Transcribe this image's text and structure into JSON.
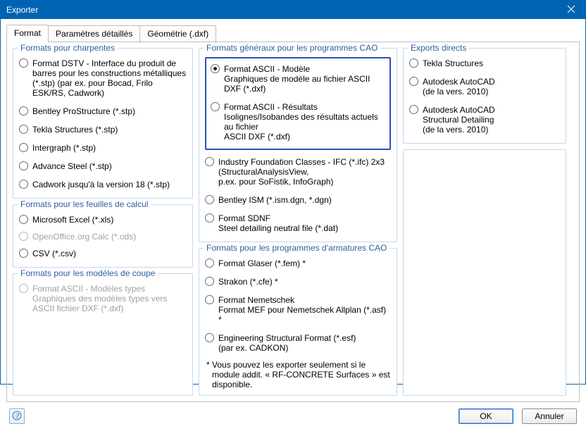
{
  "window": {
    "title": "Exporter"
  },
  "tabs": {
    "format": "Format",
    "detailed": "Paramètres détaillés",
    "geometry": "Géométrie (.dxf)"
  },
  "left": {
    "charpentes": {
      "legend": "Formats pour charpentes",
      "items": [
        {
          "label": "Format DSTV - Interface du produit de barres pour les constructions métalliques (*.stp) (par ex. pour Bocad, Frilo ESK/RS, Cadwork)"
        },
        {
          "label": "Bentley ProStructure (*.stp)"
        },
        {
          "label": "Tekla Structures (*.stp)"
        },
        {
          "label": "Intergraph (*.stp)"
        },
        {
          "label": "Advance Steel (*.stp)"
        },
        {
          "label": "Cadwork jusqu'à la version 18 (*.stp)"
        }
      ]
    },
    "feuilles": {
      "legend": "Formats pour les feuilles de calcul",
      "items": [
        {
          "label": "Microsoft Excel (*.xls)"
        },
        {
          "label": "OpenOffice.org Calc (*.ods)",
          "disabled": true
        },
        {
          "label": "CSV (*.csv)"
        }
      ]
    },
    "coupe": {
      "legend": "Formats pour les modèles de coupe",
      "item": {
        "l1": "Format ASCII - Modèles types",
        "l2": "Graphiques des modèles types vers",
        "l3": "ASCII fichier DXF (*.dxf)"
      }
    }
  },
  "mid": {
    "cao": {
      "legend": "Formats généraux pour les programmes CAO",
      "hl1": {
        "l1": "Format ASCII - Modèle",
        "l2": "Graphiques de modèle au fichier ASCII DXF (*.dxf)"
      },
      "hl2": {
        "l1": "Format ASCII - Résultats",
        "l2": "Isolignes/Isobandes des résultats actuels au fichier",
        "l3": "ASCII DXF (*.dxf)"
      },
      "ifc": {
        "l1": "Industry Foundation Classes - IFC (*.ifc) 2x3",
        "l2": "(StructuralAnalysisView,",
        "l3": "p.ex. pour SoFistik, InfoGraph)"
      },
      "ism": "Bentley ISM (*.ism.dgn, *.dgn)",
      "sdnf": {
        "l1": "Format SDNF",
        "l2": "Steel detailing neutral file (*.dat)"
      }
    },
    "arm": {
      "legend": "Formats pour les programmes d'armatures CAO",
      "glaser": "Format Glaser (*.fem)  *",
      "strakon": "Strakon (*.cfe)  *",
      "nem": {
        "l1": "Format Nemetschek",
        "l2": "Format MEF pour Nemetschek Allplan (*.asf)  *"
      },
      "esf": {
        "l1": "Engineering Structural Format (*.esf)",
        "l2": "(par ex. CADKON)"
      },
      "note": "*  Vous pouvez les exporter seulement si le module addit. « RF-CONCRETE Surfaces » est disponible."
    }
  },
  "right": {
    "legend": "Exports directs",
    "items": {
      "tekla": "Tekla Structures",
      "acad": {
        "l1": "Autodesk AutoCAD",
        "l2": "(de la vers. 2010)"
      },
      "acadsd": {
        "l1": "Autodesk AutoCAD",
        "l2": "Structural Detailing",
        "l3": "(de la vers. 2010)"
      }
    }
  },
  "buttons": {
    "ok": "OK",
    "cancel": "Annuler"
  }
}
